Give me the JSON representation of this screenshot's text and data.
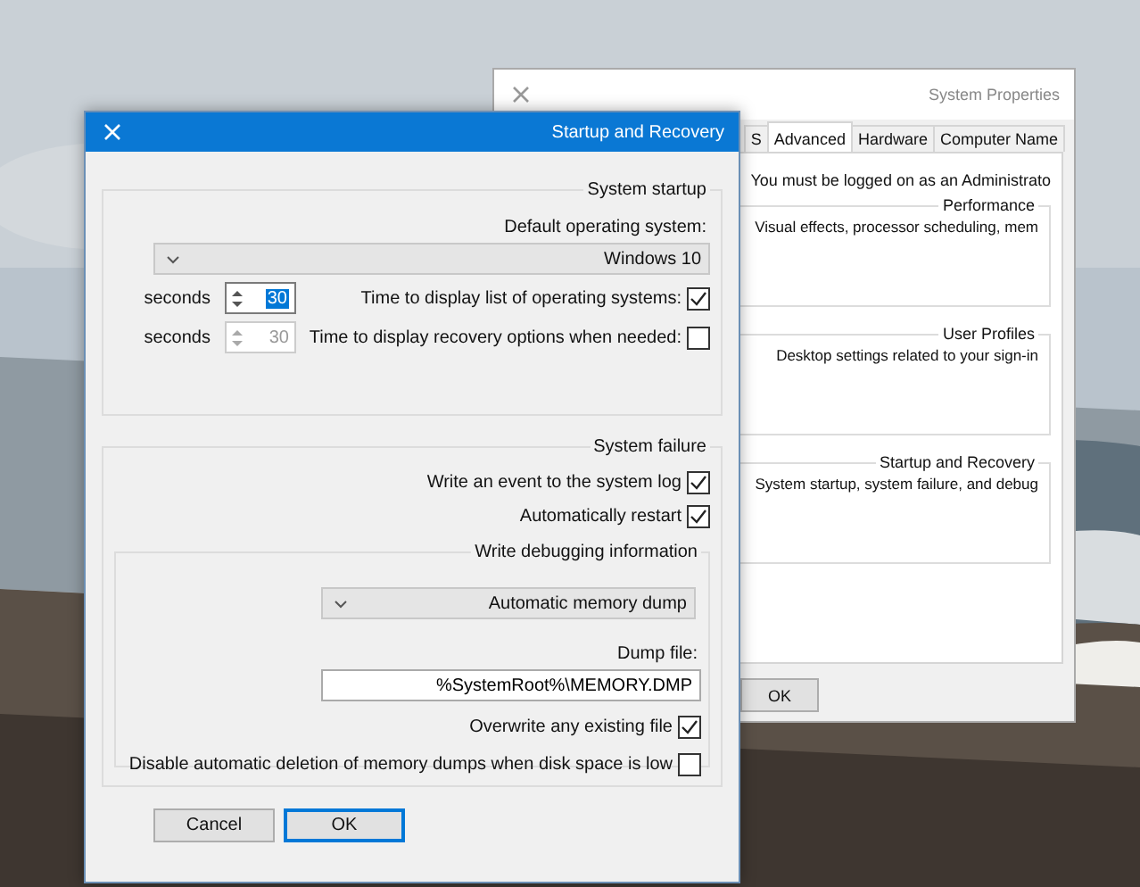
{
  "system_properties": {
    "title": "System Properties",
    "tabs": [
      {
        "label": "S",
        "selected": false
      },
      {
        "label": "Advanced",
        "selected": true
      },
      {
        "label": "Hardware",
        "selected": false
      },
      {
        "label": "Computer Name",
        "selected": false
      }
    ],
    "notice": "You must be logged on as an Administrato",
    "groups": [
      {
        "title": "Performance",
        "description": "Visual effects, processor scheduling, mem"
      },
      {
        "title": "User Profiles",
        "description": "Desktop settings related to your sign-in"
      },
      {
        "title": "Startup and Recovery",
        "description": "System startup, system failure, and debug"
      }
    ],
    "buttons": [
      "OK"
    ]
  },
  "dialog": {
    "title": "Startup and Recovery",
    "system_startup": {
      "title": "System startup",
      "default_os_label": "Default operating system:",
      "default_os": "Windows 10",
      "timeouts": [
        {
          "label": "Time to display list of operating systems:",
          "checked": true,
          "value": "30",
          "text_selected": true,
          "disabled": false,
          "unit": "seconds"
        },
        {
          "label": "Time to display recovery options when needed:",
          "checked": false,
          "value": "30",
          "text_selected": false,
          "disabled": true,
          "unit": "seconds"
        }
      ]
    },
    "system_failure": {
      "title": "System failure",
      "options": [
        {
          "label": "Write an event to the system log",
          "checked": true
        },
        {
          "label": "Automatically restart",
          "checked": true
        }
      ],
      "debugging": {
        "title": "Write debugging information",
        "dump_type": "Automatic memory dump",
        "dump_file_label": "Dump file:",
        "dump_file": "%SystemRoot%\\MEMORY.DMP",
        "options": [
          {
            "label": "Overwrite any existing file",
            "checked": true
          },
          {
            "label": "Disable automatic deletion of memory dumps when disk space is low",
            "checked": false
          }
        ]
      }
    },
    "buttons": [
      {
        "label": "Cancel",
        "default": false
      },
      {
        "label": "OK",
        "default": true
      }
    ]
  }
}
